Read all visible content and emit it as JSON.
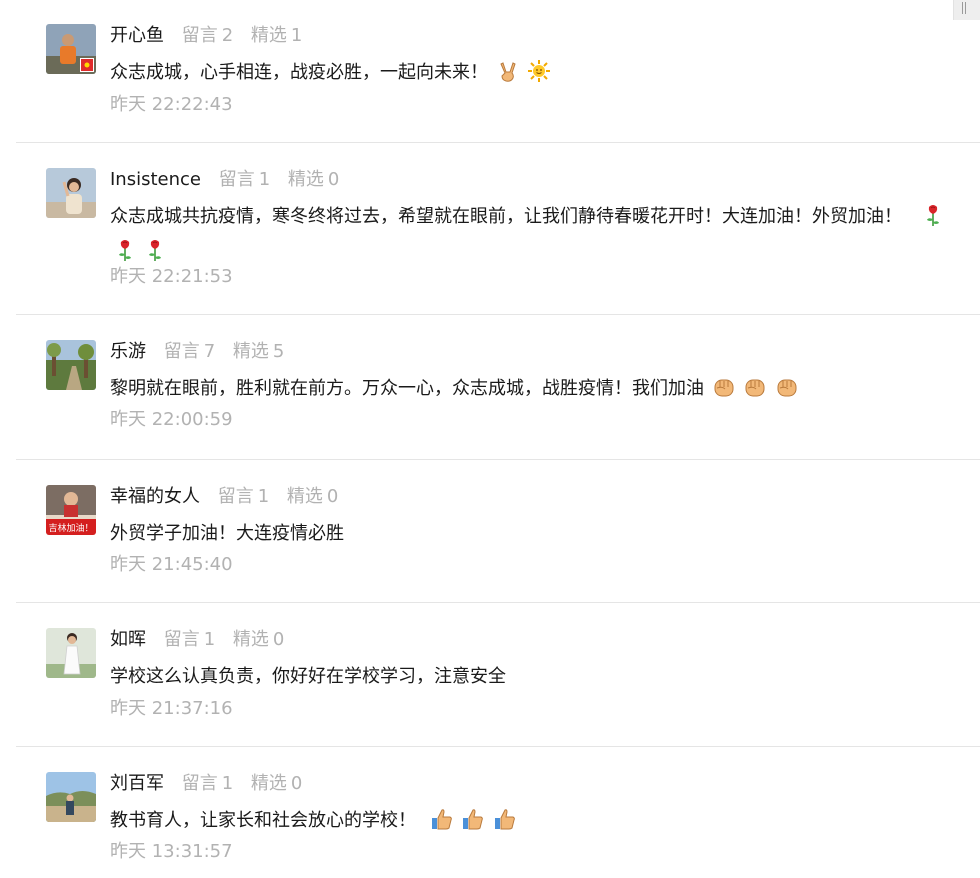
{
  "stat_labels": {
    "comments": "留言",
    "featured": "精选"
  },
  "comments": [
    {
      "nickname": "开心鱼",
      "comment_count": "2",
      "featured_count": "1",
      "text": "众志成城，心手相连，战疫必胜，一起向未来！",
      "emojis": [
        "victory-hand-icon",
        "sun-icon"
      ],
      "time": "昨天 22:22:43"
    },
    {
      "nickname": "Insistence",
      "comment_count": "1",
      "featured_count": "0",
      "text": "众志成城共抗疫情，寒冬终将过去，希望就在眼前，让我们静待春暖花开时！大连加油！外贸加油！",
      "emojis": [
        "rose-icon",
        "rose-icon",
        "rose-icon"
      ],
      "time": "昨天 22:21:53"
    },
    {
      "nickname": "乐游",
      "comment_count": "7",
      "featured_count": "5",
      "text": "黎明就在眼前，胜利就在前方。万众一心，众志成城，战胜疫情！我们加油",
      "emojis": [
        "fist-icon",
        "fist-icon",
        "fist-icon"
      ],
      "time": "昨天 22:00:59"
    },
    {
      "nickname": "幸福的女人",
      "comment_count": "1",
      "featured_count": "0",
      "text": "外贸学子加油！大连疫情必胜",
      "emojis": [],
      "avatar_text": "吉林加油！",
      "time": "昨天 21:45:40"
    },
    {
      "nickname": "如晖",
      "comment_count": "1",
      "featured_count": "0",
      "text": "学校这么认真负责，你好好在学校学习，注意安全",
      "emojis": [],
      "time": "昨天 21:37:16"
    },
    {
      "nickname": "刘百军",
      "comment_count": "1",
      "featured_count": "0",
      "text": "教书育人，让家长和社会放心的学校！",
      "emojis": [
        "thumbs-up-icon",
        "thumbs-up-icon",
        "thumbs-up-icon"
      ],
      "time": "昨天 13:31:57"
    }
  ]
}
